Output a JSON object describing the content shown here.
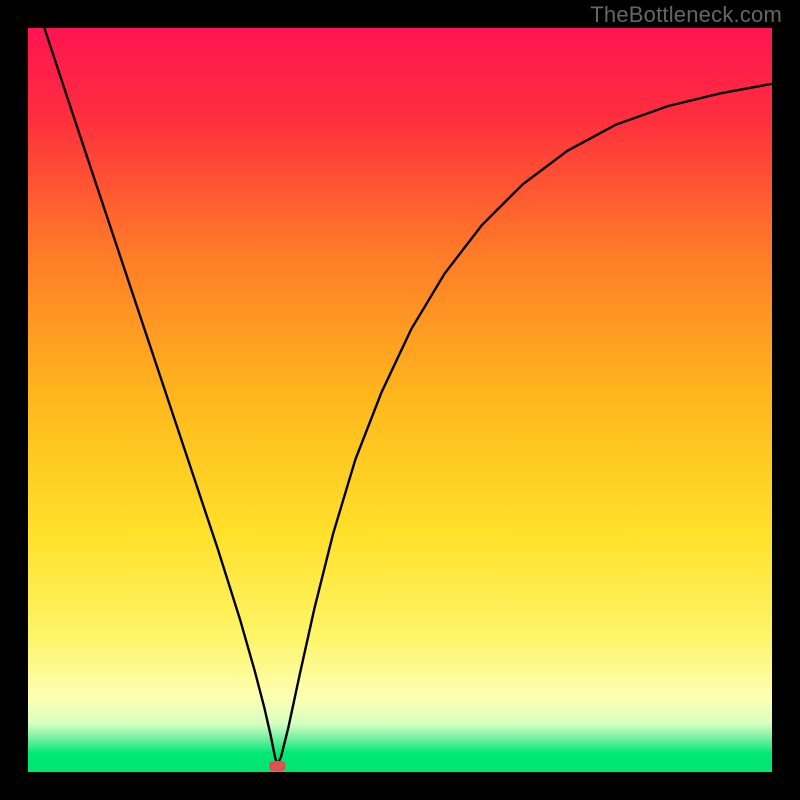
{
  "watermark": "TheBottleneck.com",
  "chart_data": {
    "type": "line",
    "title": "",
    "xlabel": "",
    "ylabel": "",
    "xlim": [
      0,
      1
    ],
    "ylim": [
      0,
      1
    ],
    "grid": false,
    "legend": false,
    "axes_visible": false,
    "background": {
      "description": "vertical rainbow gradient, red at top through orange, yellow, to green at bottom, with a sharp thin green band near the bottom edge",
      "stops": [
        {
          "pos": 0.0,
          "color": "#ff1452"
        },
        {
          "pos": 0.12,
          "color": "#ff2e3e"
        },
        {
          "pos": 0.3,
          "color": "#ff7a28"
        },
        {
          "pos": 0.5,
          "color": "#ffb81c"
        },
        {
          "pos": 0.68,
          "color": "#ffe12a"
        },
        {
          "pos": 0.82,
          "color": "#fff56a"
        },
        {
          "pos": 0.9,
          "color": "#fdffb3"
        },
        {
          "pos": 0.935,
          "color": "#d6ffc0"
        },
        {
          "pos": 0.955,
          "color": "#72f0a1"
        },
        {
          "pos": 0.975,
          "color": "#00e876"
        },
        {
          "pos": 1.0,
          "color": "#00e56f"
        }
      ]
    },
    "series": [
      {
        "name": "curve",
        "color": "#000000",
        "stroke_width": 2.4,
        "description": "V-shaped bottleneck curve: steep near-linear descent from upper-left to a sharp minimum around x≈0.33 at the bottom, then a concave rise toward upper-right, flattening slightly near the right edge.",
        "points": [
          [
            0.022,
            1.0
          ],
          [
            0.06,
            0.885
          ],
          [
            0.1,
            0.765
          ],
          [
            0.14,
            0.645
          ],
          [
            0.18,
            0.525
          ],
          [
            0.22,
            0.405
          ],
          [
            0.255,
            0.3
          ],
          [
            0.285,
            0.205
          ],
          [
            0.305,
            0.135
          ],
          [
            0.318,
            0.085
          ],
          [
            0.326,
            0.05
          ],
          [
            0.332,
            0.02
          ],
          [
            0.335,
            0.01
          ],
          [
            0.34,
            0.02
          ],
          [
            0.35,
            0.06
          ],
          [
            0.365,
            0.13
          ],
          [
            0.385,
            0.22
          ],
          [
            0.41,
            0.32
          ],
          [
            0.44,
            0.42
          ],
          [
            0.475,
            0.51
          ],
          [
            0.515,
            0.595
          ],
          [
            0.56,
            0.67
          ],
          [
            0.61,
            0.735
          ],
          [
            0.665,
            0.79
          ],
          [
            0.725,
            0.835
          ],
          [
            0.79,
            0.87
          ],
          [
            0.86,
            0.895
          ],
          [
            0.93,
            0.912
          ],
          [
            1.0,
            0.925
          ]
        ]
      }
    ],
    "markers": [
      {
        "name": "optimum-marker",
        "shape": "rounded-rect",
        "x": 0.335,
        "y": 0.008,
        "width_frac": 0.022,
        "height_frac": 0.014,
        "color": "#d9534f"
      }
    ]
  }
}
